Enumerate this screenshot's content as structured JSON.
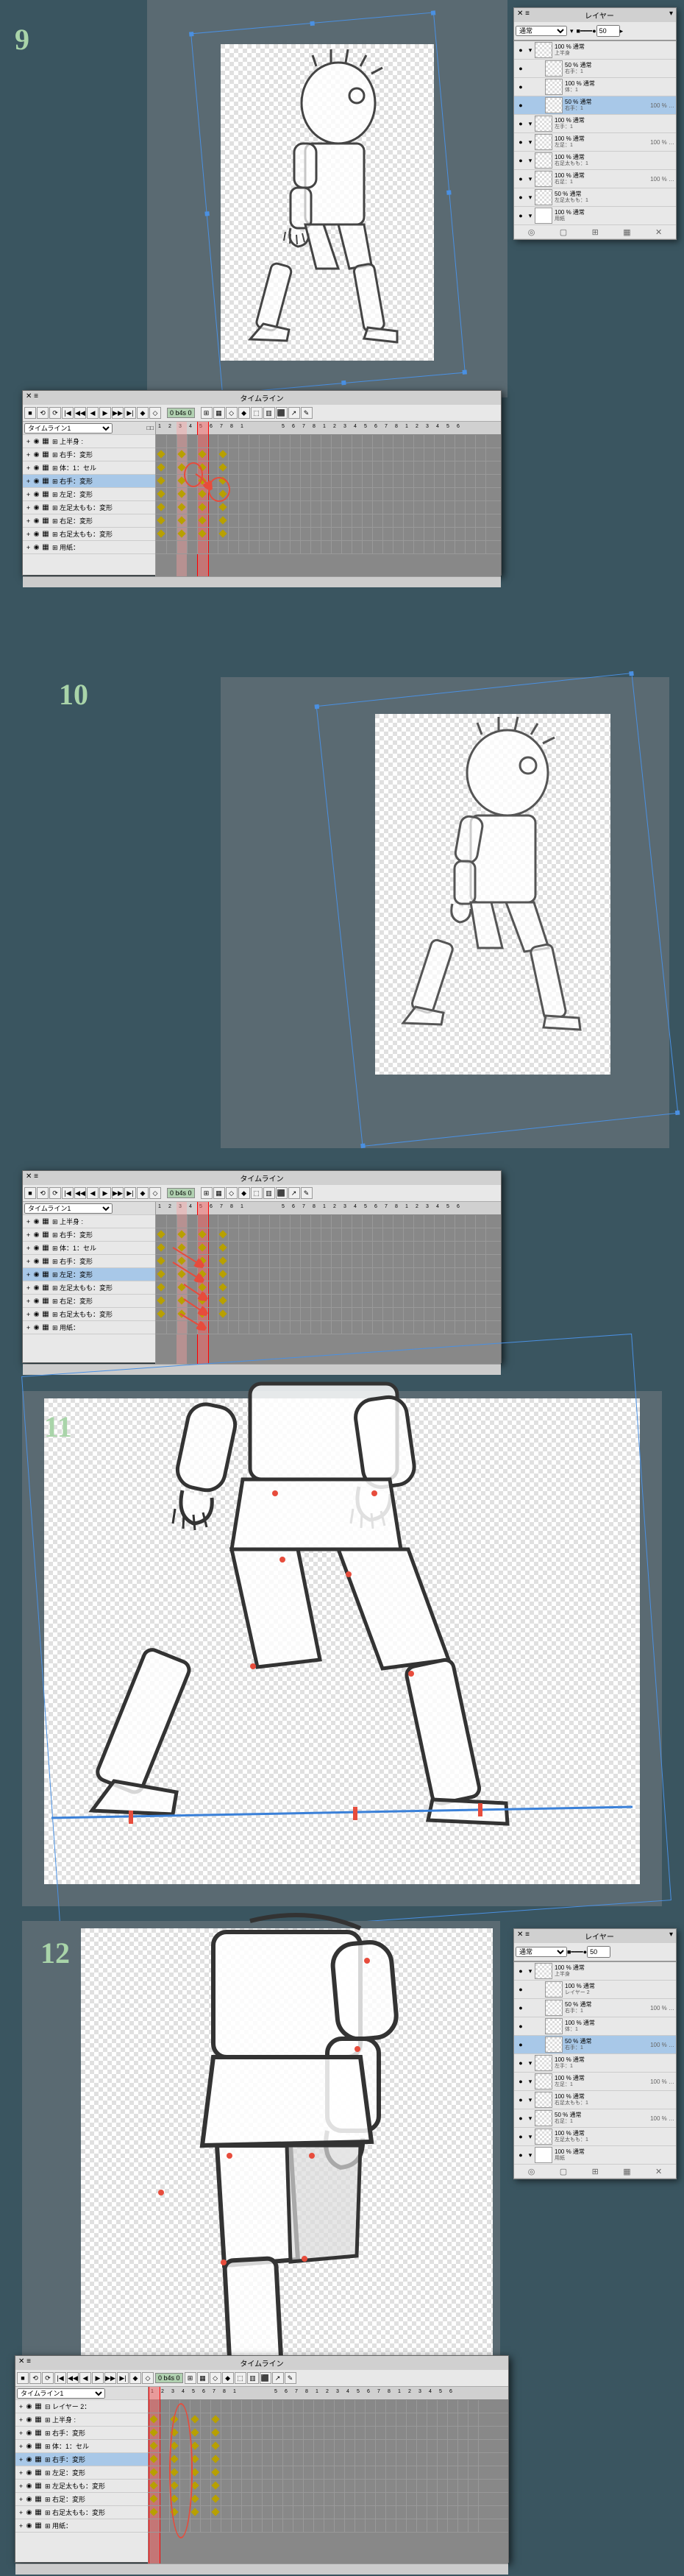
{
  "step9": {
    "num": "9"
  },
  "step10": {
    "num": "10"
  },
  "step11": {
    "num": "11"
  },
  "step12": {
    "num": "12"
  },
  "layers": {
    "title": "レイヤー",
    "mode": "通常",
    "opacity": "50",
    "items": [
      {
        "op": "100 % 通常",
        "name": "上半身",
        "indent": 0
      },
      {
        "op": "50 % 通常",
        "name": "右手：1",
        "indent": 1,
        "sel": false
      },
      {
        "op": "100 % 通常",
        "name": "体：1",
        "indent": 1
      },
      {
        "op": "50 % 通常",
        "name": "右手：1",
        "indent": 1,
        "sel": true,
        "ops": "100 % …"
      },
      {
        "op": "100 % 通常",
        "name": "左手：1",
        "indent": 0
      },
      {
        "op": "100 % 通常",
        "name": "左足：1",
        "indent": 0,
        "ops": "100 % …"
      },
      {
        "op": "100 % 通常",
        "name": "右足太もも：1",
        "indent": 0
      },
      {
        "op": "100 % 通常",
        "name": "右足：1",
        "indent": 0,
        "ops": "100 % …"
      },
      {
        "op": "50 % 通常",
        "name": "左足太もも：1",
        "indent": 0
      },
      {
        "op": "100 % 通常",
        "name": "用紙",
        "indent": 0,
        "white": true
      }
    ],
    "foot": [
      "◎",
      "▢",
      "⊞",
      "▦",
      "✕"
    ]
  },
  "layers12": {
    "title": "レイヤー",
    "mode": "通常",
    "opacity": "50",
    "items": [
      {
        "op": "100 % 通常",
        "name": "上半身",
        "indent": 0
      },
      {
        "op": "100 % 通常",
        "name": "レイヤー 2",
        "indent": 1
      },
      {
        "op": "50 % 通常",
        "name": "右手：1",
        "indent": 1,
        "ops": "100 % …"
      },
      {
        "op": "100 % 通常",
        "name": "体：1",
        "indent": 1
      },
      {
        "op": "50 % 通常",
        "name": "右手：1",
        "indent": 1,
        "sel": true,
        "ops": "100 % …"
      },
      {
        "op": "100 % 通常",
        "name": "左手：1",
        "indent": 0
      },
      {
        "op": "100 % 通常",
        "name": "左足：1",
        "indent": 0,
        "ops": "100 % …"
      },
      {
        "op": "100 % 通常",
        "name": "右足太もも：1",
        "indent": 0
      },
      {
        "op": "50 % 通常",
        "name": "右足：1",
        "indent": 0,
        "ops": "100 % …"
      },
      {
        "op": "100 % 通常",
        "name": "左足太もも：1",
        "indent": 0
      },
      {
        "op": "100 % 通常",
        "name": "用紙",
        "indent": 0,
        "white": true
      }
    ]
  },
  "timeline": {
    "title": "タイムライン",
    "name": "タイムライン1",
    "fps_label": "0 b4s 0",
    "ruler": [
      "1",
      "2",
      "3",
      "4",
      "5",
      "6",
      "7",
      "8",
      "1",
      "",
      "",
      "",
      "5",
      "6",
      "7",
      "8",
      "1",
      "2",
      "3",
      "4",
      "5",
      "6",
      "7",
      "8",
      "1",
      "2",
      "3",
      "4",
      "5",
      "6"
    ],
    "tracks9": [
      {
        "lbl": "⊞ 上半身 :"
      },
      {
        "lbl": "⊞ 右手：変形"
      },
      {
        "lbl": "⊞ 体：1：セル"
      },
      {
        "lbl": "⊞ 右手：変形",
        "sel": true
      },
      {
        "lbl": "⊞ 左足：変形"
      },
      {
        "lbl": "⊞ 左足太もも：変形"
      },
      {
        "lbl": "⊞ 右足：変形"
      },
      {
        "lbl": "⊞ 右足太もも：変形"
      },
      {
        "lbl": "⊞ 用紙："
      }
    ],
    "tracks10": [
      {
        "lbl": "⊞ 上半身 :"
      },
      {
        "lbl": "⊞ 右手：変形"
      },
      {
        "lbl": "⊞ 体：1：セル"
      },
      {
        "lbl": "⊞ 右手：変形"
      },
      {
        "lbl": "⊞ 左足：変形",
        "sel": true
      },
      {
        "lbl": "⊞ 左足太もも：変形"
      },
      {
        "lbl": "⊞ 右足：変形"
      },
      {
        "lbl": "⊞ 右足太もも：変形"
      },
      {
        "lbl": "⊞ 用紙："
      }
    ],
    "tracks12": [
      {
        "lbl": "⊟ レイヤー 2："
      },
      {
        "lbl": "⊞ 上半身 :"
      },
      {
        "lbl": "⊞ 右手：変形"
      },
      {
        "lbl": "⊞ 体：1：セル"
      },
      {
        "lbl": "⊞ 右手：変形",
        "sel": true
      },
      {
        "lbl": "⊞ 左足：変形"
      },
      {
        "lbl": "⊞ 左足太もも：変形"
      },
      {
        "lbl": "⊞ 右足：変形"
      },
      {
        "lbl": "⊞ 右足太もも：変形"
      },
      {
        "lbl": "⊞ 用紙："
      }
    ]
  },
  "tb": {
    "btns": [
      "■",
      "⟲",
      "⟳",
      "|◀",
      "◀◀",
      "◀",
      "▶",
      "▶▶",
      "▶|",
      "◆",
      "◇"
    ],
    "btns2": [
      "⊞",
      "▦",
      "◇",
      "◆",
      "⬚",
      "▥",
      "⬛",
      "↗",
      "✎"
    ]
  }
}
